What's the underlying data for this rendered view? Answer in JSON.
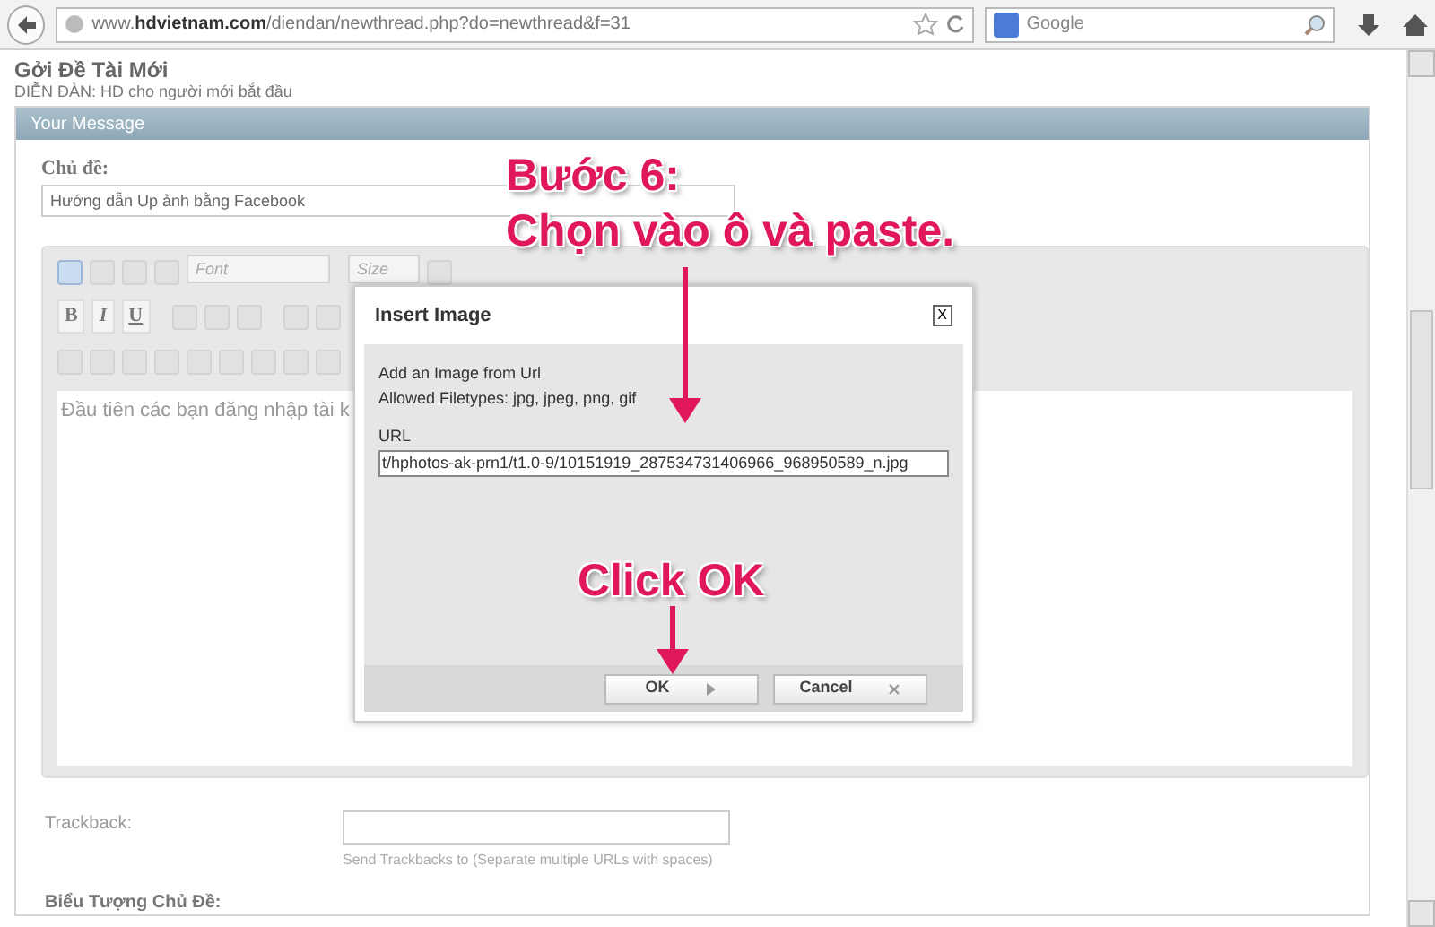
{
  "browser": {
    "url": "www.**hdvietnam.com**/diendan/newthread.php?do=newthread&f=31",
    "search_placeholder": "Google"
  },
  "page": {
    "title": "Gởi Đề Tài Mới",
    "breadcrumb": "DIỄN ĐÀN: HD cho người mới bắt đầu"
  },
  "panel": {
    "header": "Your Message"
  },
  "subject": {
    "label": "Chủ đề:",
    "value": "Hướng dẫn Up ảnh bằng Facebook"
  },
  "editor": {
    "font_select": "Font",
    "size_select": "Size",
    "format_buttons": [
      "B",
      "I",
      "U"
    ],
    "body_text": "Đầu tiên các bạn đăng nhập tài k"
  },
  "dialog": {
    "title": "Insert Image",
    "close": "X",
    "lines": [
      "Add an Image from Url",
      "Allowed Filetypes: jpg, jpeg, png, gif"
    ],
    "url_label": "URL",
    "url_value": "t/hphotos-ak-prn1/t1.0-9/10151919_287534731406966_968950589_n.jpg",
    "buttons": [
      {
        "label": "OK",
        "kind": "ok"
      },
      {
        "label": "Cancel",
        "kind": "cancel"
      }
    ]
  },
  "trackback": {
    "label": "Trackback:",
    "hint": "Send Trackbacks to (Separate multiple URLs with spaces)"
  },
  "next_section": "Biểu Tượng Chủ Đề:",
  "annotations": [
    {
      "text": "Bước 6:",
      "kind": "step"
    },
    {
      "text": "Chọn vào ô và paste.",
      "kind": "step"
    },
    {
      "text": "Click OK",
      "kind": "ok"
    }
  ]
}
